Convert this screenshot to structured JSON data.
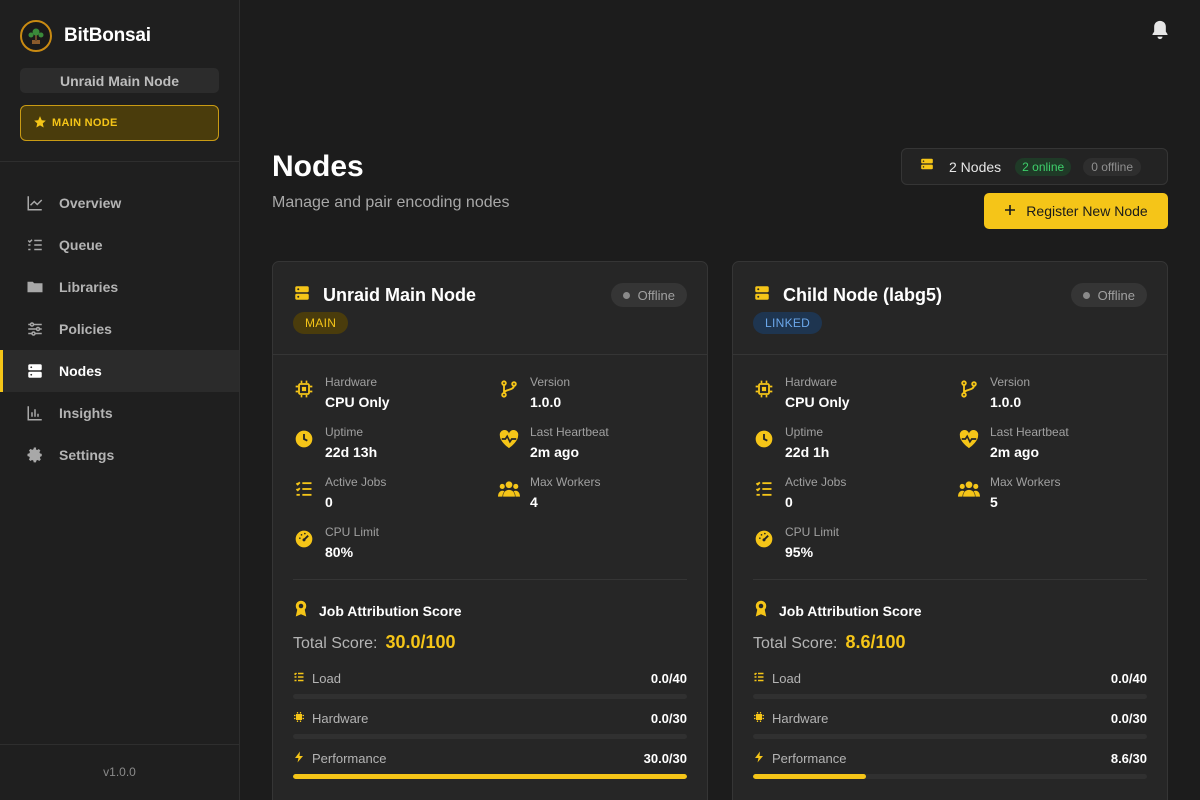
{
  "app": {
    "name": "BitBonsai",
    "version": "v1.0.0"
  },
  "sidebar": {
    "node_name": "Unraid Main Node",
    "main_node_badge": "MAIN NODE",
    "items": [
      {
        "label": "Overview",
        "icon": "chart-line-icon"
      },
      {
        "label": "Queue",
        "icon": "list-check-icon"
      },
      {
        "label": "Libraries",
        "icon": "folder-icon"
      },
      {
        "label": "Policies",
        "icon": "sliders-icon"
      },
      {
        "label": "Nodes",
        "icon": "server-icon",
        "active": true
      },
      {
        "label": "Insights",
        "icon": "bar-chart-icon"
      },
      {
        "label": "Settings",
        "icon": "gear-icon"
      }
    ]
  },
  "header": {
    "title": "Nodes",
    "subtitle": "Manage and pair encoding nodes",
    "summary": {
      "count": "2 Nodes",
      "online": "2 online",
      "offline": "0 offline"
    },
    "register_label": "Register New Node"
  },
  "labels": {
    "hardware": "Hardware",
    "version": "Version",
    "uptime": "Uptime",
    "heartbeat": "Last Heartbeat",
    "active_jobs": "Active Jobs",
    "max_workers": "Max Workers",
    "cpu_limit": "CPU Limit",
    "score_title": "Job Attribution Score",
    "total_score": "Total Score:",
    "load": "Load",
    "hardware_metric": "Hardware",
    "performance": "Performance"
  },
  "nodes": [
    {
      "name": "Unraid Main Node",
      "status": "Offline",
      "role": "MAIN",
      "hardware": "CPU Only",
      "version": "1.0.0",
      "uptime": "22d 13h",
      "heartbeat": "2m ago",
      "active_jobs": "0",
      "max_workers": "4",
      "cpu_limit": "80%",
      "total_score": "30.0/100",
      "load": "0.0/40",
      "load_fraction": 0,
      "hardware_score": "0.0/30",
      "hardware_fraction": 0,
      "performance": "30.0/30",
      "performance_fraction": 1.0
    },
    {
      "name": "Child Node (labg5)",
      "status": "Offline",
      "role": "LINKED",
      "hardware": "CPU Only",
      "version": "1.0.0",
      "uptime": "22d 1h",
      "heartbeat": "2m ago",
      "active_jobs": "0",
      "max_workers": "5",
      "cpu_limit": "95%",
      "total_score": "8.6/100",
      "load": "0.0/40",
      "load_fraction": 0,
      "hardware_score": "0.0/30",
      "hardware_fraction": 0,
      "performance": "8.6/30",
      "performance_fraction": 0.287
    }
  ],
  "colors": {
    "accent": "#f5c518",
    "online": "#3ecf6a",
    "linked": "#6ba7ea"
  }
}
